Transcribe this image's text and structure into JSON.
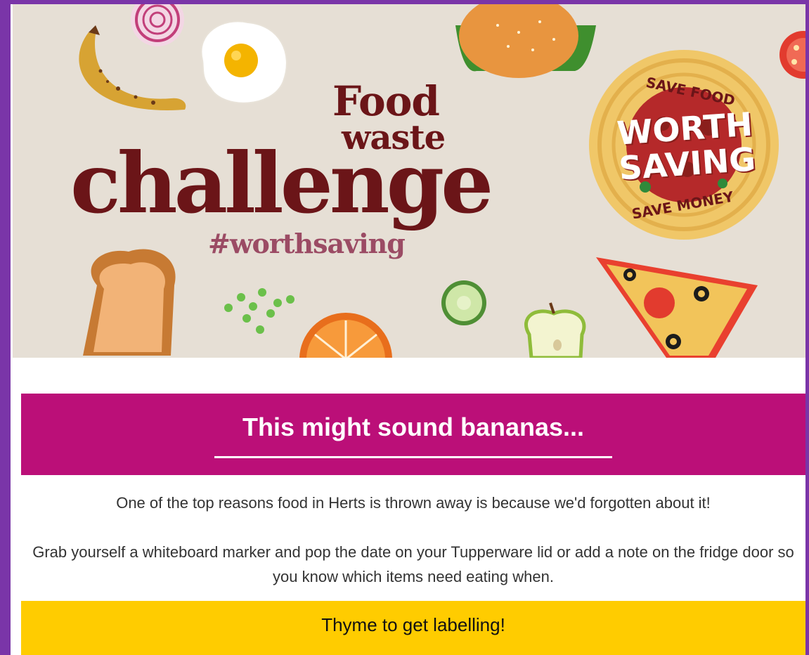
{
  "banner": {
    "title_line1": "Food",
    "title_line2": "waste",
    "title_line3": "challenge",
    "hashtag": "#worthsaving",
    "badge": {
      "top_text": "SAVE FOOD",
      "main_text": "WORTH SAVING",
      "bottom_text": "SAVE MONEY"
    },
    "foods": [
      "onion-icon",
      "banana-icon",
      "egg-icon",
      "burger-icon",
      "tomato-icon",
      "pasta-icon",
      "toast-icon",
      "peas-icon",
      "orange-icon",
      "cucumber-icon",
      "apple-icon",
      "pizza-icon"
    ]
  },
  "section": {
    "heading": "This might sound bananas...",
    "paragraph1": "One of the top reasons food in Herts is thrown away is because we'd forgotten about it!",
    "paragraph2": "Grab yourself a whiteboard marker and pop the date on your Tupperware lid or add a note on the fridge door so you know which items need eating when."
  },
  "cta": {
    "label": "Thyme to get labelling!"
  },
  "colors": {
    "frame": "#7a35a8",
    "banner_bg": "#e6dfd5",
    "title_text": "#6b1518",
    "header_band": "#bb0f78",
    "cta_bg": "#ffcc00"
  }
}
